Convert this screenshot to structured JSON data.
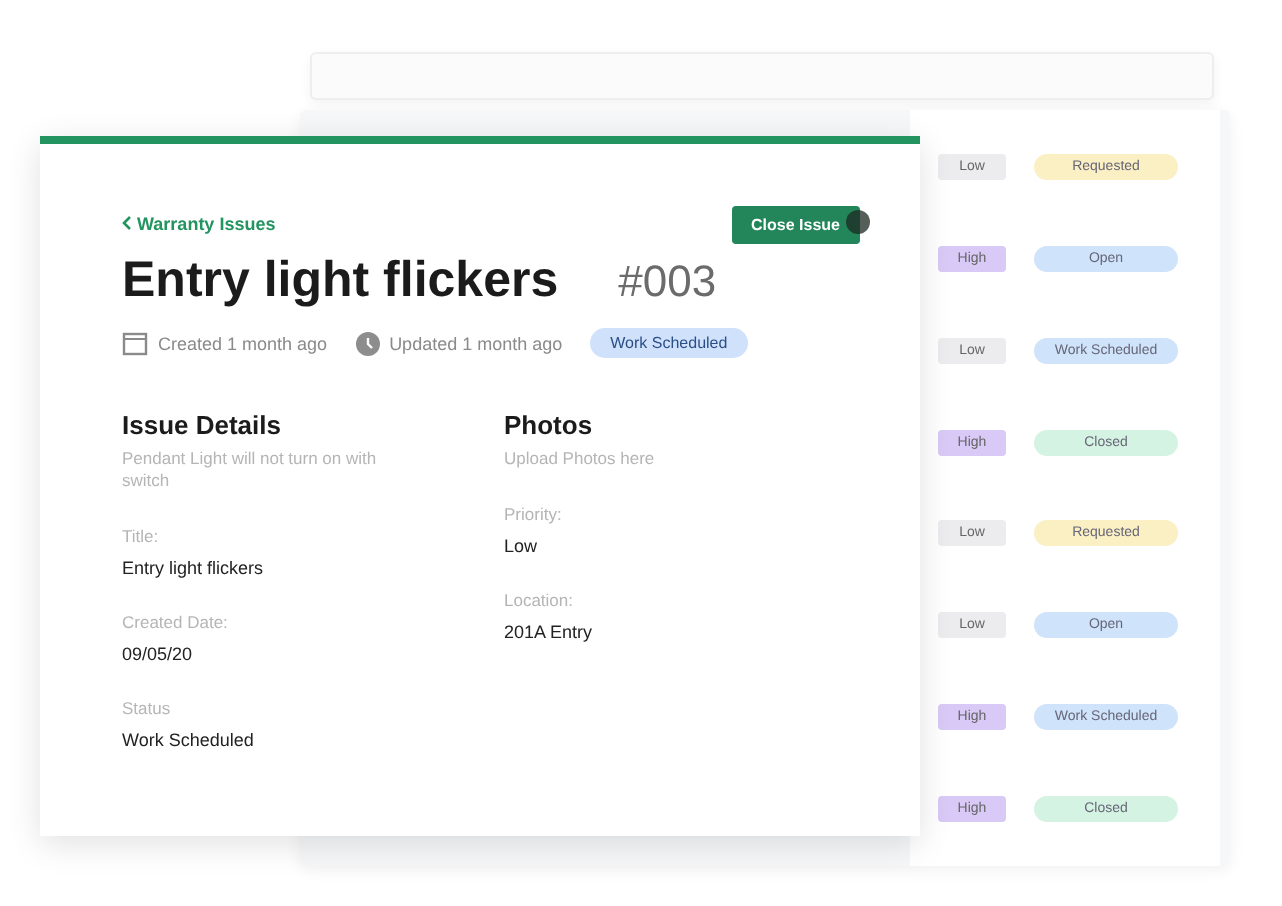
{
  "issue": {
    "back_link": "Warranty Issues",
    "close_button": "Close Issue",
    "title": "Entry light flickers",
    "number": "#003",
    "created": "Created 1 month ago",
    "updated": "Updated 1 month ago",
    "status_badge": "Work Scheduled"
  },
  "details": {
    "heading": "Issue Details",
    "description": "Pendant Light will not turn on with switch",
    "fields": [
      {
        "label": "Title:",
        "value": "Entry light flickers"
      },
      {
        "label": "Created Date:",
        "value": "09/05/20"
      },
      {
        "label": "Status",
        "value": "Work Scheduled"
      }
    ]
  },
  "photos": {
    "heading": "Photos",
    "placeholder": "Upload Photos here",
    "fields": [
      {
        "label": "Priority:",
        "value": "Low"
      },
      {
        "label": "Location:",
        "value": "201A Entry"
      }
    ]
  },
  "background_rows": [
    {
      "priority": {
        "label": "Low",
        "color": "#ececee"
      },
      "status": {
        "label": "Requested",
        "color": "#fbefc4"
      }
    },
    {
      "priority": {
        "label": "High",
        "color": "#d9c9f7"
      },
      "status": {
        "label": "Open",
        "color": "#cfe3fb"
      }
    },
    {
      "priority": {
        "label": "Low",
        "color": "#ececee"
      },
      "status": {
        "label": "Work Scheduled",
        "color": "#cfe3fb"
      }
    },
    {
      "priority": {
        "label": "High",
        "color": "#d9c9f7"
      },
      "status": {
        "label": "Closed",
        "color": "#d5f3e2"
      }
    },
    {
      "priority": {
        "label": "Low",
        "color": "#ececee"
      },
      "status": {
        "label": "Requested",
        "color": "#fbefc4"
      }
    },
    {
      "priority": {
        "label": "Low",
        "color": "#ececee"
      },
      "status": {
        "label": "Open",
        "color": "#cfe3fb"
      }
    },
    {
      "priority": {
        "label": "High",
        "color": "#d9c9f7"
      },
      "status": {
        "label": "Work Scheduled",
        "color": "#cfe3fb"
      }
    },
    {
      "priority": {
        "label": "High",
        "color": "#d9c9f7"
      },
      "status": {
        "label": "Closed",
        "color": "#d5f3e2"
      }
    }
  ]
}
